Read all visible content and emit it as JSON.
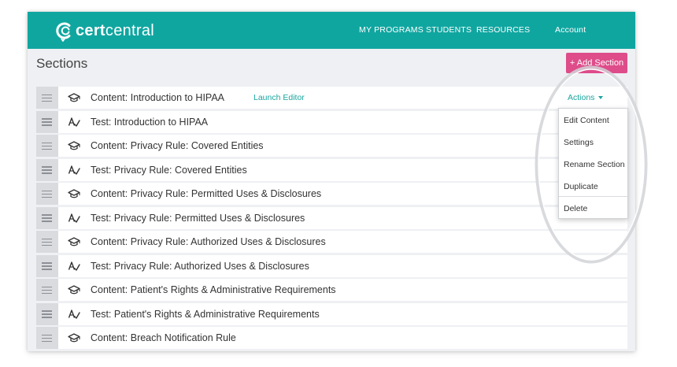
{
  "header": {
    "logo_bold": "cert",
    "logo_light": "central",
    "nav": [
      "MY PROGRAMS",
      "STUDENTS",
      "RESOURCES",
      "Account"
    ]
  },
  "page": {
    "title": "Sections",
    "add_button": "+ Add Section"
  },
  "sections": [
    {
      "type": "content",
      "label": "Content: Introduction to HIPAA"
    },
    {
      "type": "test",
      "label": "Test: Introduction to HIPAA"
    },
    {
      "type": "content",
      "label": "Content: Privacy Rule: Covered Entities"
    },
    {
      "type": "test",
      "label": "Test: Privacy Rule: Covered Entities"
    },
    {
      "type": "content",
      "label": "Content: Privacy Rule: Permitted Uses & Disclosures"
    },
    {
      "type": "test",
      "label": "Test: Privacy Rule: Permitted Uses & Disclosures"
    },
    {
      "type": "content",
      "label": "Content: Privacy Rule: Authorized Uses & Disclosures"
    },
    {
      "type": "test",
      "label": "Test: Privacy Rule: Authorized Uses & Disclosures"
    },
    {
      "type": "content",
      "label": "Content: Patient's Rights & Administrative Requirements"
    },
    {
      "type": "test",
      "label": "Test: Patient's Rights & Administrative Requirements"
    },
    {
      "type": "content",
      "label": "Content: Breach Notification Rule"
    }
  ],
  "first_row": {
    "launch_editor": "Launch Editor",
    "actions": "Actions"
  },
  "actions_menu": [
    "Edit Content",
    "Settings",
    "Rename Section",
    "Duplicate",
    "Delete"
  ],
  "icons": {
    "content": "graduation-cap-icon",
    "test": "checkmark-a-icon",
    "handle": "drag-handle-icon"
  },
  "colors": {
    "header": "#10a6a0",
    "add_button": "#de4c8a",
    "link": "#1aa59f"
  }
}
